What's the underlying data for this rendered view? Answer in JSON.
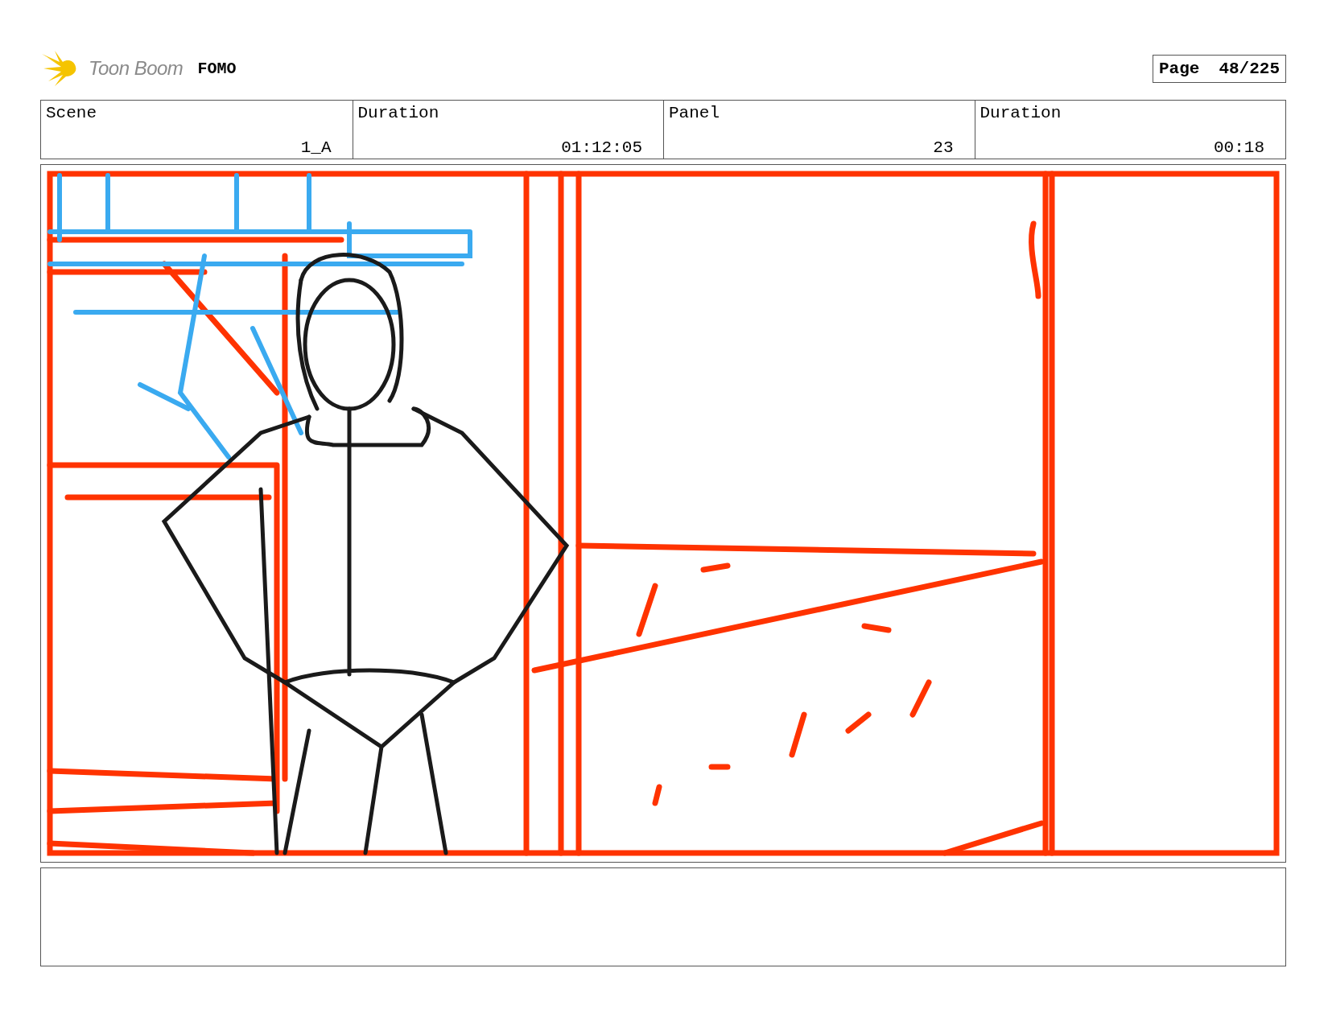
{
  "header": {
    "logo_text": "Toon Boom",
    "project": "FOMO",
    "page_label": "Page",
    "page_number": "48/225"
  },
  "info_fields": [
    {
      "label": "Scene",
      "value": "1_A"
    },
    {
      "label": "Duration",
      "value": "01:12:05"
    },
    {
      "label": "Panel",
      "value": "23"
    },
    {
      "label": "Duration",
      "value": "00:18"
    }
  ]
}
